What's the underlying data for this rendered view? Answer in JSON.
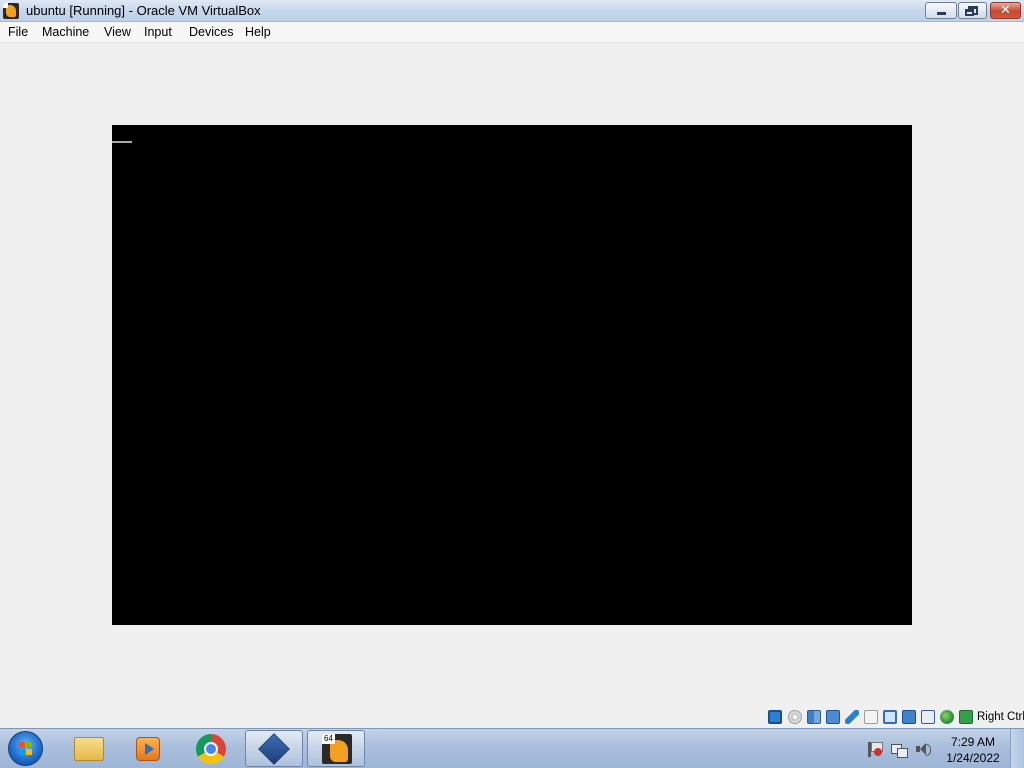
{
  "window": {
    "title": "ubuntu [Running] - Oracle VM VirtualBox",
    "close_glyph": "✕"
  },
  "menu": {
    "items": [
      "File",
      "Machine",
      "View",
      "Input",
      "Devices",
      "Help"
    ]
  },
  "statusbar": {
    "icons": [
      "hard-disk-icon",
      "optical-drive-icon",
      "audio-icon",
      "network-icon",
      "usb-icon",
      "shared-folders-icon",
      "display-icon",
      "video-capture-icon",
      "cpu-icon",
      "mouse-integration-icon",
      "keyboard-icon"
    ],
    "host_key": "Right Ctrl"
  },
  "taskbar": {
    "pinned": [
      "windows-explorer-icon",
      "media-player-icon",
      "chrome-icon",
      "virtualbox-icon",
      "virtualbox-vm-icon"
    ],
    "vm_badge": "64",
    "time": "7:29 AM",
    "date": "1/24/2022"
  },
  "colors": {
    "vm_background": "#000000",
    "desktop_background": "#f0f0f0"
  }
}
